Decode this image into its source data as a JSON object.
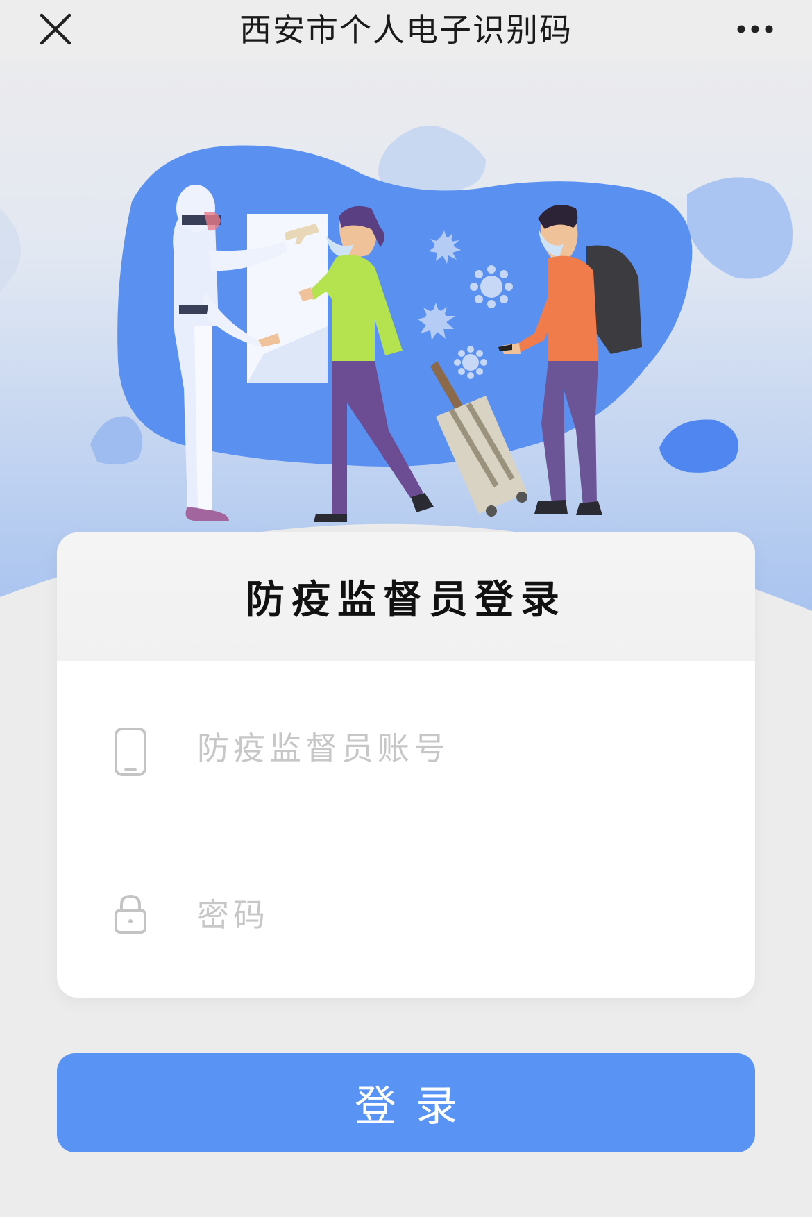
{
  "nav": {
    "title": "西安市个人电子识别码",
    "close_icon": "close-icon",
    "more_icon": "more-icon"
  },
  "hero": {
    "illustration": "temperature-check-illustration",
    "colors": {
      "blob": "#5a90f0",
      "skin": "#f0c29a",
      "orange_shirt": "#ef7c4a",
      "green_top": "#b5e34f"
    }
  },
  "login": {
    "title": "防疫监督员登录",
    "account": {
      "placeholder": "防疫监督员账号",
      "icon": "phone-icon",
      "value": ""
    },
    "password": {
      "placeholder": "密码",
      "icon": "lock-icon",
      "value": ""
    },
    "submit_label": "登录"
  },
  "colors": {
    "accent": "#5993f4",
    "background": "#ececec"
  }
}
